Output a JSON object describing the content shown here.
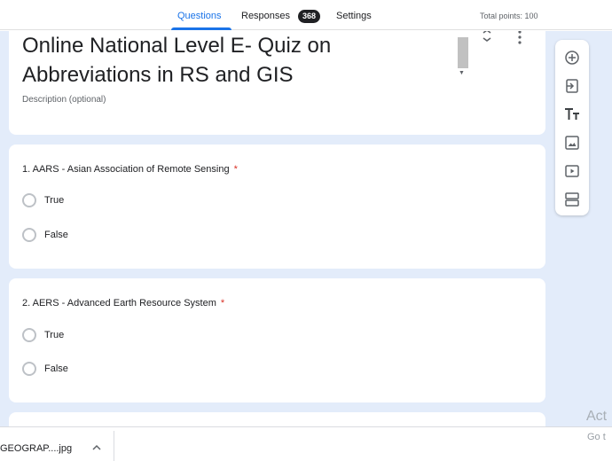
{
  "tabs": {
    "questions": "Questions",
    "responses": "Responses",
    "responses_count": "368",
    "settings": "Settings",
    "total_points": "Total points: 100"
  },
  "form": {
    "title": "Online National Level E- Quiz on\nAbbreviations in RS and GIS",
    "description_placeholder": "Description (optional)"
  },
  "questions": [
    {
      "text": "1. AARS - Asian Association of Remote Sensing",
      "required_mark": "*",
      "options": [
        "True",
        "False"
      ]
    },
    {
      "text": "2. AERS - Advanced Earth Resource System",
      "required_mark": "*",
      "options": [
        "True",
        "False"
      ]
    }
  ],
  "toolbar": {
    "icons": [
      "add-question-icon",
      "import-questions-icon",
      "add-title-icon",
      "add-image-icon",
      "add-video-icon",
      "add-section-icon"
    ]
  },
  "overlay": {
    "activate_partial": "Act",
    "goto_partial": "Go t"
  },
  "downloads": {
    "file_name": "GEOGRAP....jpg"
  },
  "colors": {
    "accent": "#1a73e8",
    "canvas_bg": "#e3ecfa",
    "required": "#d93025"
  }
}
